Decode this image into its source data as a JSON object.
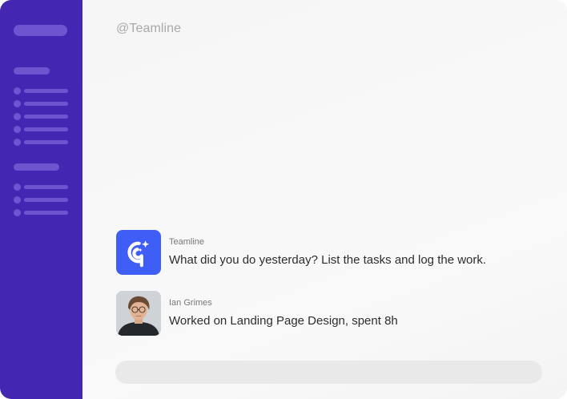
{
  "header": {
    "handle": "@Teamline"
  },
  "conversation": {
    "messages": [
      {
        "sender": "Teamline",
        "text": "What did you do yesterday? List the tasks and log the work.",
        "avatar_icon": "teamline-logo-icon",
        "avatar_color": "#3f5ef5"
      },
      {
        "sender": "Ian Grimes",
        "text": "Worked on Landing Page Design, spent 8h",
        "avatar_icon": "user-avatar"
      }
    ]
  },
  "composer": {
    "placeholder": ""
  },
  "colors": {
    "sidebar_bg": "#4326b1",
    "sidebar_skeleton": "#6d55cf",
    "main_bg": "#f7f7f7",
    "brand_accent": "#3f5ef5"
  }
}
